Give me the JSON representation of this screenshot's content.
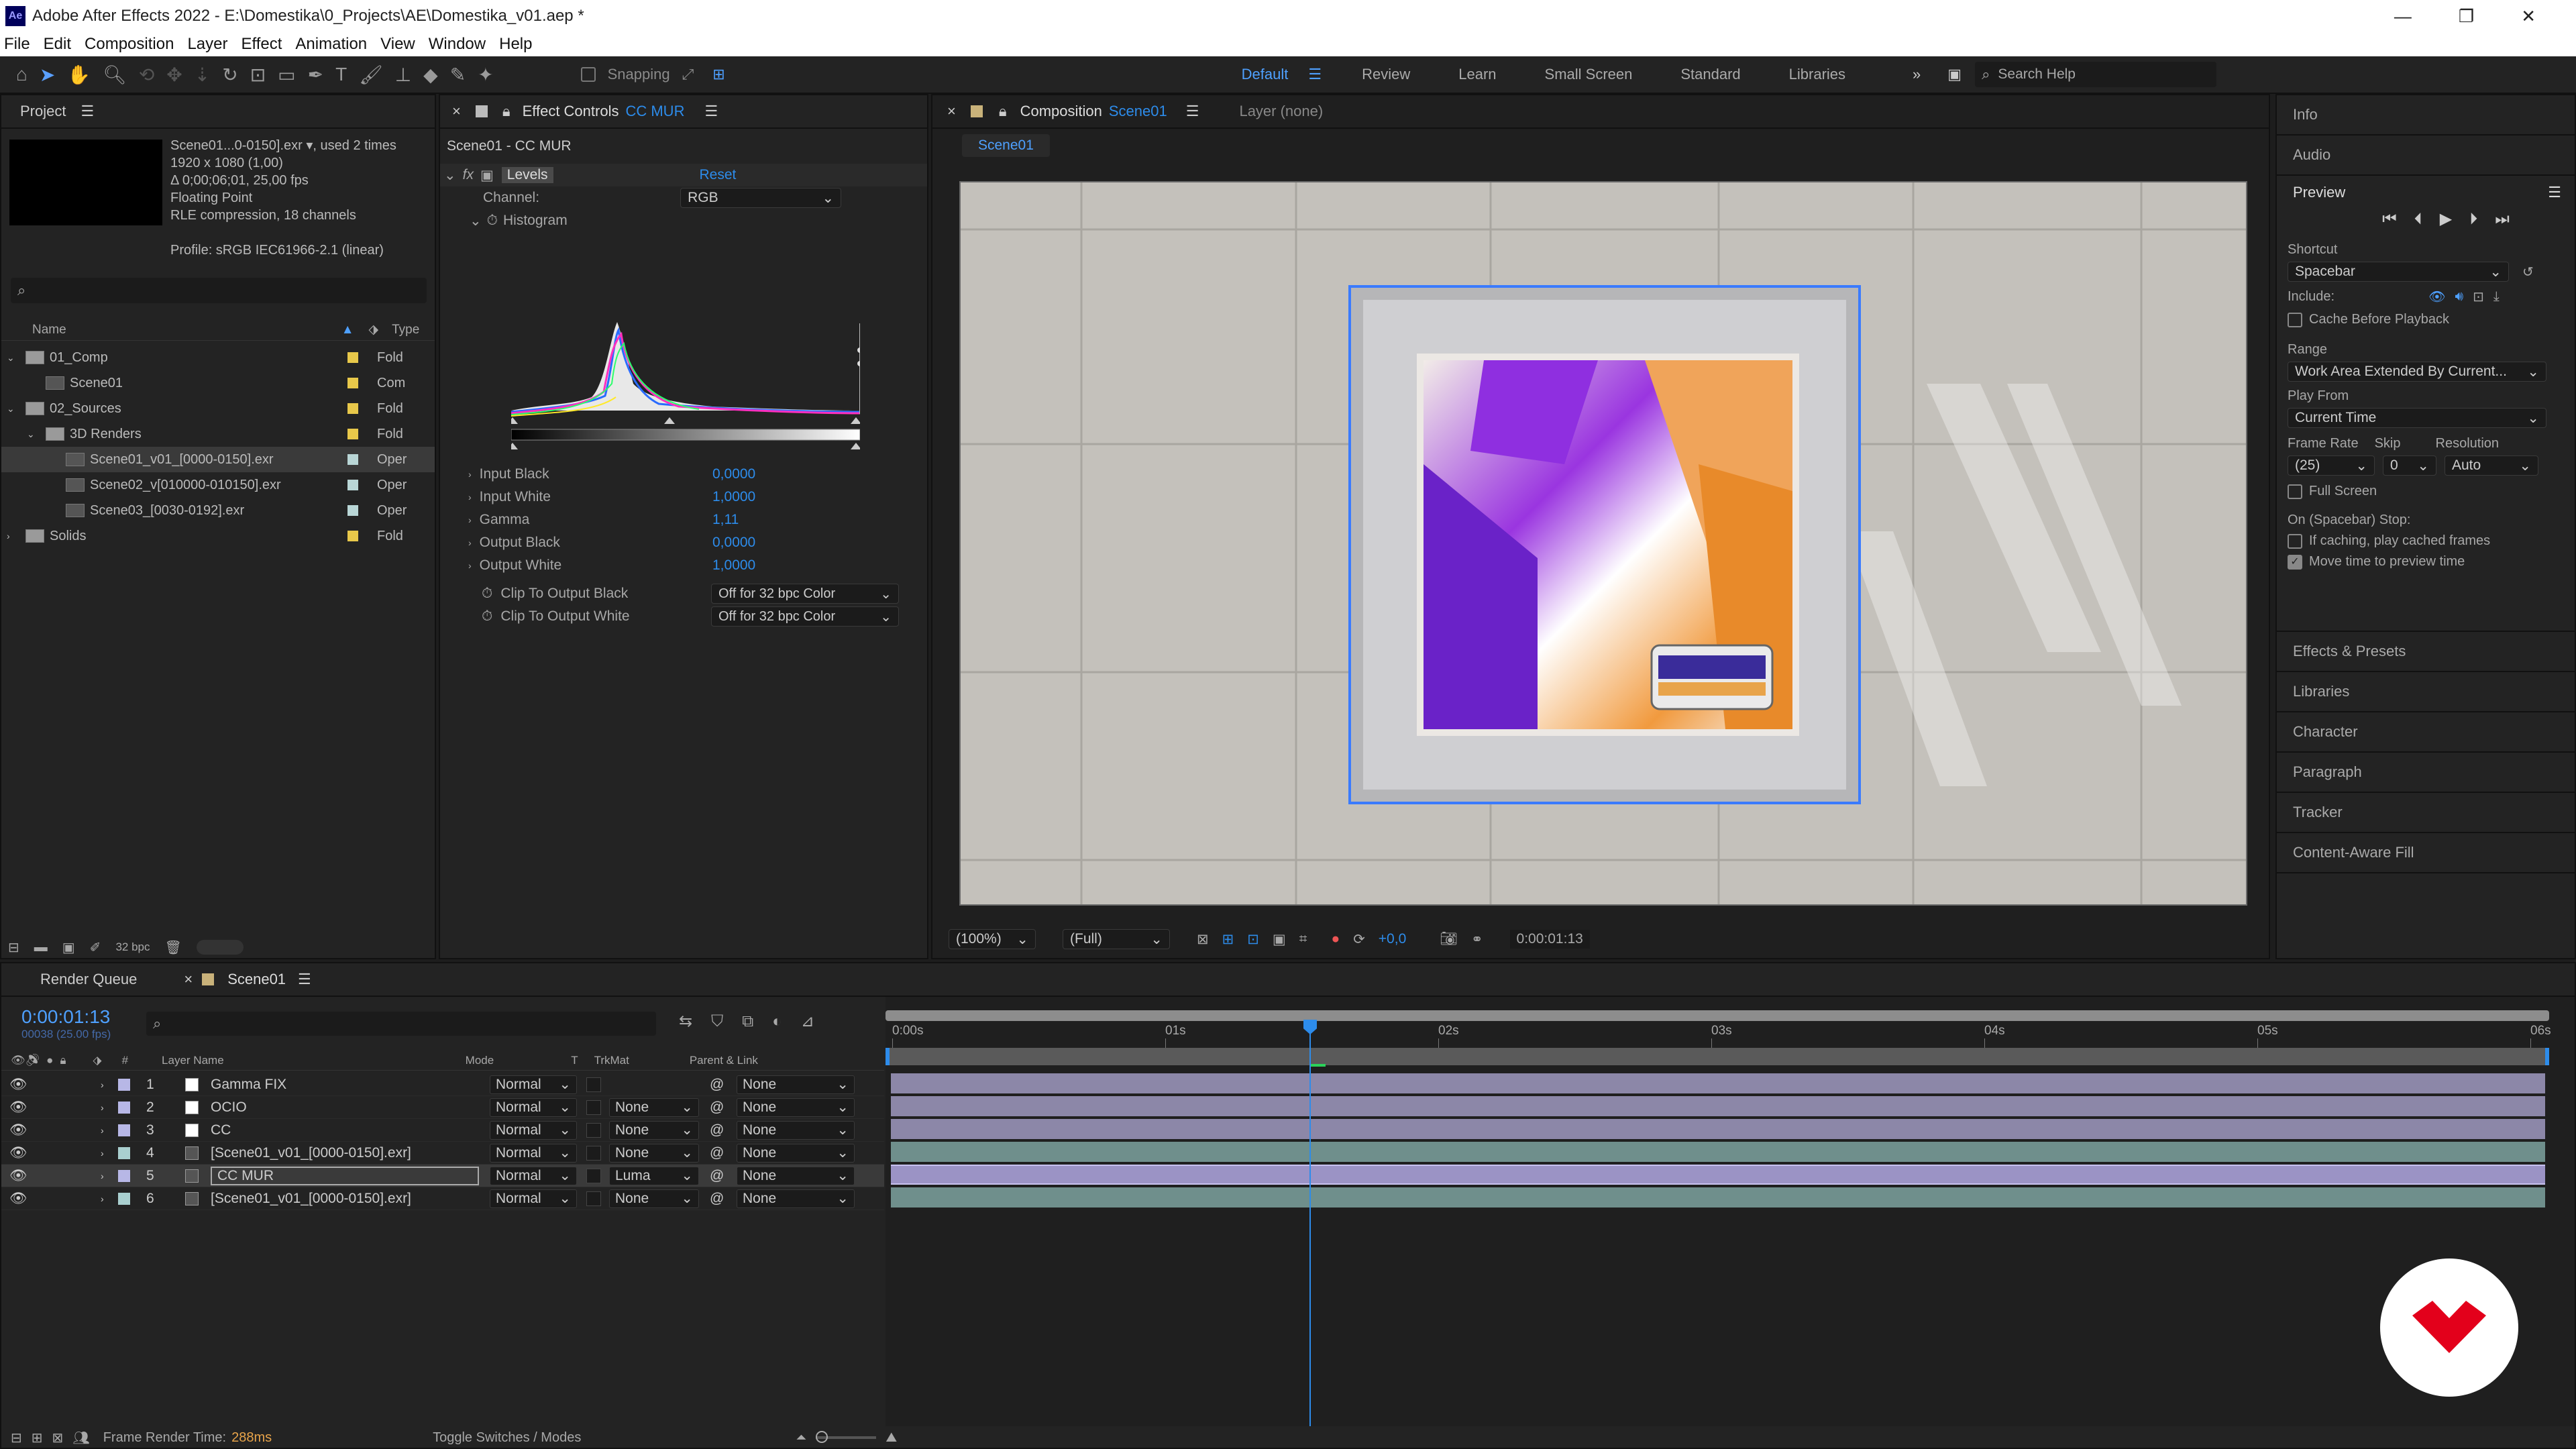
{
  "app": {
    "title": "Adobe After Effects 2022 - E:\\Domestika\\0_Projects\\AE\\Domestika_v01.aep *",
    "logo": "Ae"
  },
  "menu": [
    "File",
    "Edit",
    "Composition",
    "Layer",
    "Effect",
    "Animation",
    "View",
    "Window",
    "Help"
  ],
  "toolbar": {
    "snapping": "Snapping",
    "workspaces": [
      "Default",
      "Review",
      "Learn",
      "Small Screen",
      "Standard",
      "Libraries"
    ],
    "search": "Search Help"
  },
  "project": {
    "title": "Project",
    "item_name": "Scene01...0-0150].exr ▾",
    "used": ", used 2 times",
    "lines": [
      "1920 x 1080 (1,00)",
      "Δ 0;00;06;01, 25,00 fps",
      "Floating Point",
      "RLE compression, 18 channels"
    ],
    "profile": "Profile: sRGB IEC61966-2.1 (linear)",
    "col_name": "Name",
    "col_type": "Type",
    "bpc": "32 bpc",
    "items": [
      {
        "name": "01_Comp",
        "type": "Fold",
        "color": "#e8c84a"
      },
      {
        "name": "Scene01",
        "type": "Com",
        "color": "#e8c84a"
      },
      {
        "name": "02_Sources",
        "type": "Fold",
        "color": "#e8c84a"
      },
      {
        "name": "3D Renders",
        "type": "Fold",
        "color": "#e8c84a"
      },
      {
        "name": "Scene01_v01_[0000-0150].exr",
        "type": "Oper",
        "color": "#b9d6d6"
      },
      {
        "name": "Scene02_v[010000-010150].exr",
        "type": "Oper",
        "color": "#b9d6d6"
      },
      {
        "name": "Scene03_[0030-0192].exr",
        "type": "Oper",
        "color": "#b9d6d6"
      },
      {
        "name": "Solids",
        "type": "Fold",
        "color": "#e8c84a"
      }
    ]
  },
  "effects": {
    "tab": "Effect Controls",
    "layer": "CC MUR",
    "path": "Scene01 - CC MUR",
    "effect": "Levels",
    "reset": "Reset",
    "channel_label": "Channel:",
    "channel": "RGB",
    "histogram": "Histogram",
    "params": [
      {
        "label": "Input Black",
        "value": "0,0000"
      },
      {
        "label": "Input White",
        "value": "1,0000"
      },
      {
        "label": "Gamma",
        "value": "1,11"
      },
      {
        "label": "Output Black",
        "value": "0,0000"
      },
      {
        "label": "Output White",
        "value": "1,0000"
      }
    ],
    "clip_black": "Clip To Output Black",
    "clip_black_val": "Off for 32 bpc Color",
    "clip_white": "Clip To Output White",
    "clip_white_val": "Off for 32 bpc Color"
  },
  "comp": {
    "tab": "Composition",
    "name": "Scene01",
    "layer_tab": "Layer (none)",
    "crumb": "Scene01",
    "zoom": "(100%)",
    "quality": "(Full)",
    "exposure": "+0,0",
    "time": "0:00:01:13"
  },
  "right": {
    "info": "Info",
    "audio": "Audio",
    "preview": "Preview",
    "shortcut_label": "Shortcut",
    "shortcut": "Spacebar",
    "include": "Include:",
    "cache": "Cache Before Playback",
    "range_label": "Range",
    "range": "Work Area Extended By Current...",
    "playfrom_label": "Play From",
    "playfrom": "Current Time",
    "fr_label": "Frame Rate",
    "skip_label": "Skip",
    "res_label": "Resolution",
    "fr": "(25)",
    "skip": "0",
    "res": "Auto",
    "fullscreen": "Full Screen",
    "stop_label": "On (Spacebar) Stop:",
    "if_caching": "If caching, play cached frames",
    "move_time": "Move time to preview time",
    "panels": [
      "Effects & Presets",
      "Libraries",
      "Character",
      "Paragraph",
      "Tracker",
      "Content-Aware Fill"
    ]
  },
  "timeline": {
    "render_queue": "Render Queue",
    "tab": "Scene01",
    "timecode": "0:00:01:13",
    "frames": "00038 (25.00 fps)",
    "cols": {
      "num": "#",
      "name": "Layer Name",
      "mode": "Mode",
      "t": "T",
      "trkmat": "TrkMat",
      "parent": "Parent & Link"
    },
    "ruler": [
      "0:00s",
      "01s",
      "02s",
      "03s",
      "04s",
      "05s",
      "06s"
    ],
    "layers": [
      {
        "n": "1",
        "name": "Gamma FIX",
        "mode": "Normal",
        "trk": "",
        "parent": "None",
        "color": "#b7b7e6",
        "bar": "#8c87a8"
      },
      {
        "n": "2",
        "name": "OCIO",
        "mode": "Normal",
        "trk": "None",
        "parent": "None",
        "color": "#b7b7e6",
        "bar": "#8c87a8"
      },
      {
        "n": "3",
        "name": "CC",
        "mode": "Normal",
        "trk": "None",
        "parent": "None",
        "color": "#b7b7e6",
        "bar": "#8c87a8"
      },
      {
        "n": "4",
        "name": "[Scene01_v01_[0000-0150].exr]",
        "mode": "Normal",
        "trk": "None",
        "parent": "None",
        "color": "#a9cfcf",
        "bar": "#6f8f8c"
      },
      {
        "n": "5",
        "name": "CC MUR",
        "mode": "Normal",
        "trk": "Luma",
        "parent": "None",
        "color": "#b7b7e6",
        "bar": "#9b93c5"
      },
      {
        "n": "6",
        "name": "[Scene01_v01_[0000-0150].exr]",
        "mode": "Normal",
        "trk": "None",
        "parent": "None",
        "color": "#a9cfcf",
        "bar": "#6f8f8c"
      }
    ],
    "render_time_label": "Frame Render Time:",
    "render_time": "288ms",
    "toggle": "Toggle Switches / Modes"
  }
}
